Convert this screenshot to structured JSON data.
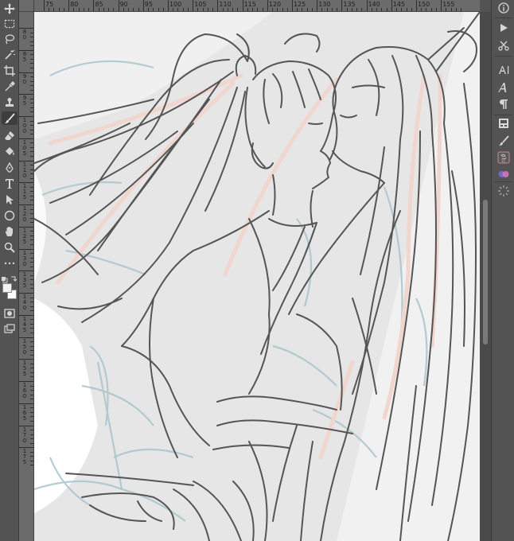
{
  "rulers": {
    "top": [
      "75",
      "80",
      "85",
      "90",
      "95",
      "100",
      "105",
      "110",
      "115",
      "120",
      "125",
      "130",
      "135",
      "140",
      "145",
      "150",
      "155"
    ],
    "left": [
      "8",
      "9",
      "10",
      "11",
      "12",
      "13",
      "14",
      "15",
      "16",
      "17"
    ]
  },
  "left_toolbar": {
    "tools": [
      {
        "name": "move-tool",
        "icon": "move-icon"
      },
      {
        "name": "marquee-tool",
        "icon": "marquee-icon"
      },
      {
        "name": "lasso-tool",
        "icon": "lasso-icon"
      },
      {
        "name": "magic-wand-tool",
        "icon": "magic-wand-icon"
      },
      {
        "name": "crop-tool",
        "icon": "crop-icon"
      },
      {
        "name": "eyedropper-tool",
        "icon": "eyedropper-icon"
      },
      {
        "name": "stamp-tool",
        "icon": "stamp-icon"
      },
      {
        "name": "brush-tool",
        "icon": "brush-icon"
      },
      {
        "name": "eraser-tool",
        "icon": "eraser-icon"
      },
      {
        "name": "paint-bucket-tool",
        "icon": "paint-bucket-icon"
      },
      {
        "name": "pen-tool",
        "icon": "pen-icon"
      },
      {
        "name": "type-tool",
        "icon": "type-icon"
      },
      {
        "name": "path-selection-tool",
        "icon": "arrow-icon"
      },
      {
        "name": "ellipse-tool",
        "icon": "ellipse-icon"
      },
      {
        "name": "hand-tool",
        "icon": "hand-icon"
      },
      {
        "name": "zoom-tool",
        "icon": "zoom-icon"
      },
      {
        "name": "more-tools",
        "icon": "ellipsis-icon"
      }
    ],
    "foreground_color": "#f2f2f2",
    "background_color": "#ffffff"
  },
  "right_panel": {
    "tools": [
      {
        "name": "info-panel",
        "icon": "info-icon"
      },
      {
        "name": "actions-panel",
        "icon": "play-icon"
      },
      {
        "name": "tools-panel",
        "icon": "scissors-icon"
      },
      {
        "name": "character-panel",
        "icon": "character-icon"
      },
      {
        "name": "glyphs-panel",
        "icon": "glyph-icon"
      },
      {
        "name": "paragraph-panel",
        "icon": "paragraph-icon"
      },
      {
        "name": "libraries-panel",
        "icon": "libraries-icon"
      },
      {
        "name": "brush-settings-panel",
        "icon": "brush-settings-icon"
      },
      {
        "name": "clone-source-panel",
        "icon": "clone-source-icon"
      },
      {
        "name": "color-panel",
        "icon": "swatch-icon"
      },
      {
        "name": "adjustments-panel",
        "icon": "sun-icon"
      }
    ]
  },
  "colors": {
    "chrome": "#535353",
    "ruler": "#6b6b6b",
    "canvas": "#e9e9e9",
    "line": "#555555",
    "ribbon": "#f0d6cf",
    "sketch_blue": "#a9c4cc"
  }
}
